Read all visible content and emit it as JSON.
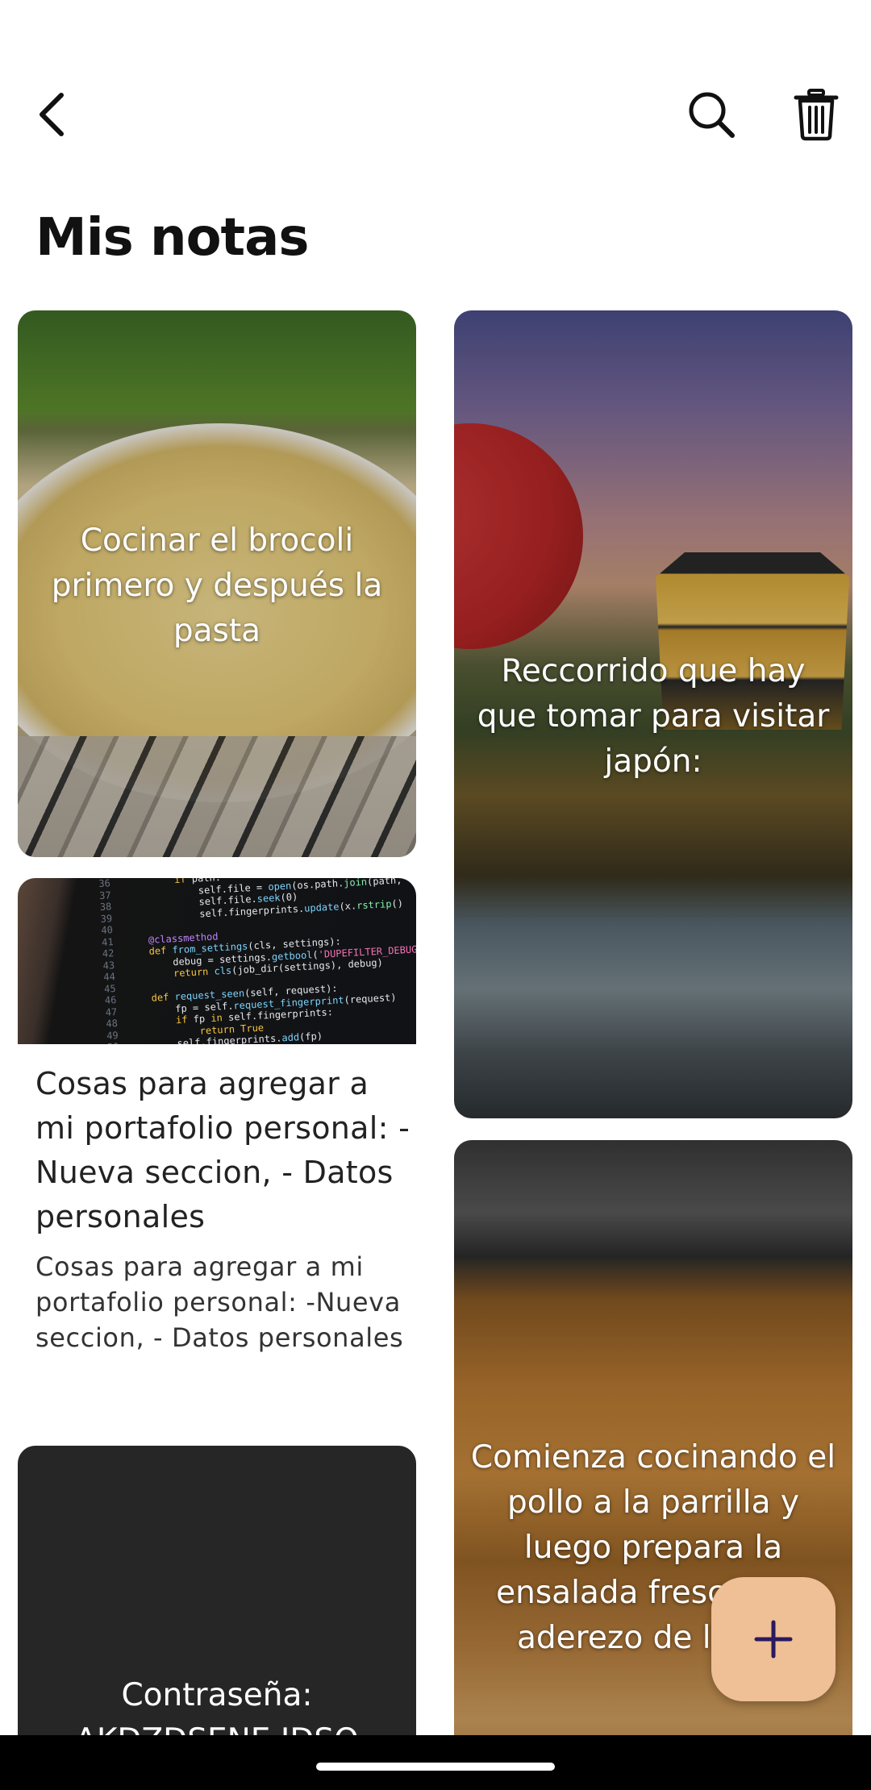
{
  "header": {
    "title": "Mis notas",
    "icons": [
      "back-arrow-icon",
      "search-icon",
      "trash-icon"
    ]
  },
  "notes": [
    {
      "id": "pasta",
      "text": "Cocinar el brocoli primero y después la pasta",
      "image": "pasta-photo"
    },
    {
      "id": "portfolio",
      "title": "Cosas para agregar a mi portafolio personal: -Nueva seccion, - Datos personales",
      "body": "Cosas para agregar a mi portafolio personal: -Nueva seccion, - Datos personales",
      "image": "code-screen-photo"
    },
    {
      "id": "password",
      "text": "Contraseña: AKDZDSENE IDSO"
    },
    {
      "id": "japan",
      "text": "Reccorrido que hay que tomar para visitar japón:",
      "image": "japan-temple-photo"
    },
    {
      "id": "chicken",
      "text": "Comienza cocinando el pollo a la parrilla y luego prepara la ensalada fresca con aderezo de limón",
      "image": "grilled-chicken-photo"
    }
  ],
  "fab": {
    "icon": "plus-icon",
    "color": "#efbf96"
  },
  "colors": {
    "background": "#ffffff",
    "title": "#111111",
    "password_card": "#262626",
    "nav_bar": "#000000"
  }
}
